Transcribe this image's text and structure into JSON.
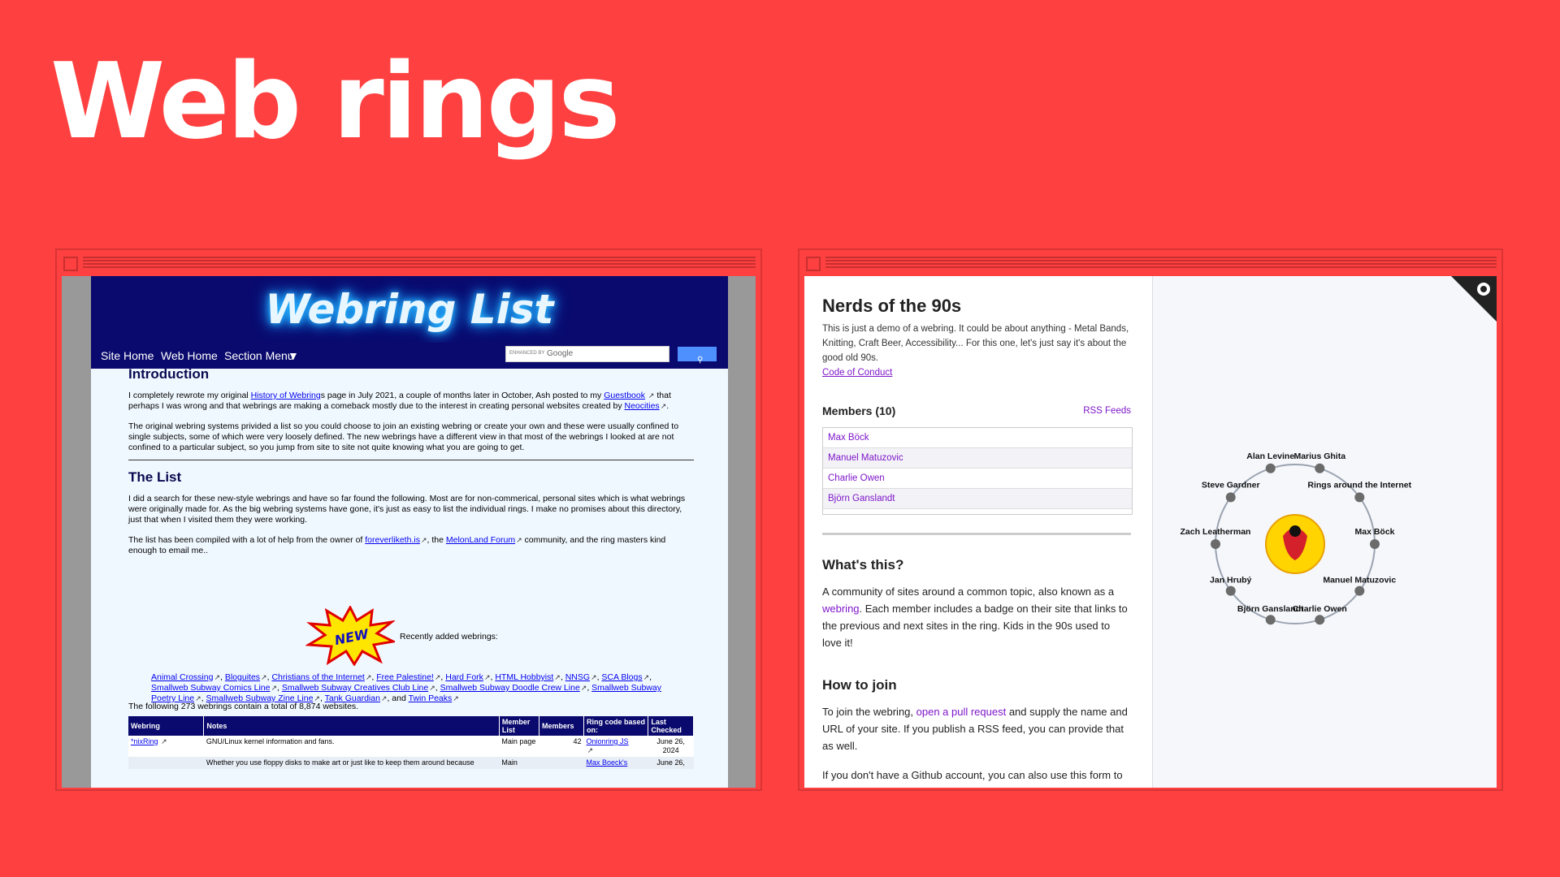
{
  "slide": {
    "title": "Web rings"
  },
  "left": {
    "logo": "Webring List",
    "nav": [
      "Site Home",
      "Web Home",
      "Section Menu",
      "▼"
    ],
    "search": {
      "prefix": "ENHANCED BY",
      "brand": "Google"
    },
    "intro": {
      "heading": "Introduction",
      "p1": [
        "I completely rewrote my original ",
        "History of Webring",
        "s page in July 2021, a couple of months later in October, Ash posted to my ",
        "Guestbook",
        " that perhaps I was wrong and that webrings are making a comeback mostly due to the interest in creating personal websites created by ",
        "Neocities",
        "."
      ],
      "p2": "The original webring systems privided a list so you could choose to join an existing webring or create your own and these were usually confined to single subjects, some of which were very loosely defined. The new webrings have a different view in that most of the webrings I looked at are not confined to a particular subject, so you jump from site to site not quite knowing what you are going to get."
    },
    "list": {
      "heading": "The List",
      "p1": "I did a search for these new-style webrings and have so far found the following. Most are for non-commerical, personal sites which is what webrings were originally made for. As the big webring systems have gone, it's just as easy to list the individual rings. I make no promises about this directory, just that when I visited them they were working.",
      "p2": [
        "The list has been compiled with a lot of help from the owner of ",
        "foreverliketh.is",
        ", the ",
        "MelonLand Forum",
        " community, and the ring masters kind enough to email me.."
      ],
      "new_badge": "NEW",
      "recent_label": "Recently added webrings:",
      "recent_rings": [
        "Animal Crossing",
        "Bloguites",
        "Christians of the Internet",
        "Free Palestine!",
        "Hard Fork",
        "HTML Hobbyist",
        "NNSG",
        "SCA Blogs",
        "Smallweb Subway Comics Line",
        "Smallweb Subway Creatives Club Line",
        "Smallweb Subway Doodle Crew Line",
        "Smallweb Subway Poetry Line",
        "Smallweb Subway Zine Line",
        "Tank Guardian",
        "Twin Peaks"
      ],
      "and_word": ", and ",
      "summary": "The following 273 webrings contain a total of 8,874 websites."
    },
    "table": {
      "headers": [
        "Webring",
        "Notes",
        "Member List",
        "Members",
        "Ring code based on:",
        "Last Checked"
      ],
      "rows": [
        {
          "name": "*nixRing",
          "notes": "GNU/Linux kernel information and fans.",
          "member_list": "Main page",
          "members": "42",
          "code": "Onionring JS",
          "checked": "June 26, 2024"
        },
        {
          "name": "",
          "notes": "Whether you use floppy disks to make art or just like to keep them around because",
          "member_list": "Main",
          "members": "",
          "code": "Max Boeck's",
          "checked": "June 26,"
        }
      ]
    }
  },
  "right": {
    "title": "Nerds of the 90s",
    "desc": "This is just a demo of a webring. It could be about anything - Metal Bands, Knitting, Craft Beer, Accessibility... For this one, let's just say it's about the good old 90s.",
    "coc": "Code of Conduct",
    "members_heading": "Members (10)",
    "rss": "RSS Feeds",
    "members": [
      "Max Böck",
      "Manuel Matuzovic",
      "Charlie Owen",
      "Björn Ganslandt"
    ],
    "whats_this": {
      "heading": "What's this?",
      "parts": [
        "A community of sites around a common topic, also known as a ",
        "webring",
        ". Each member includes a badge on their site that links to the previous and next sites in the ring. Kids in the 90s used to love it!"
      ]
    },
    "how_to_join": {
      "heading": "How to join",
      "parts": [
        "To join the webring, ",
        "open a pull request",
        " and supply the name and URL of your site. If you publish a RSS feed, you can provide that as well."
      ],
      "p2": "If you don't have a Github account, you can also use this form to"
    },
    "ring_nodes": [
      "Alan Levine",
      "Marius Ghita",
      "Rings around the Internet",
      "Max Böck",
      "Manuel Matuzovic",
      "Charlie Owen",
      "Björn Ganslandt",
      "Jan Hrubý",
      "Zach Leatherman",
      "Steve Gardner"
    ],
    "colors": {
      "background": "#ff4040",
      "link": "#7e16c9",
      "navy": "#0a0a6e"
    }
  }
}
